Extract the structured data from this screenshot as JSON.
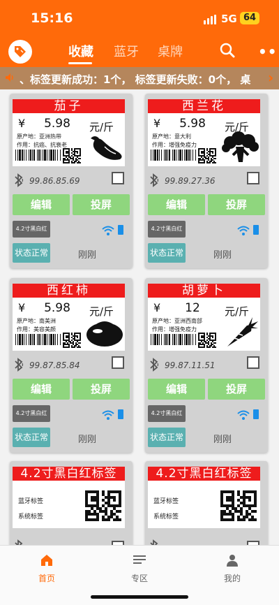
{
  "status_bar": {
    "time": "15:16",
    "network": "5G",
    "battery": "64"
  },
  "header": {
    "tabs": [
      {
        "label": "收藏"
      },
      {
        "label": "蓝牙"
      },
      {
        "label": "桌牌"
      }
    ],
    "logo_icon": "price-tag-icon",
    "search_icon": "search-icon",
    "more_label": "•••"
  },
  "marquee": {
    "text": "、标签更新成功：1个，  标签更新失败：0个，    桌",
    "arrow": "›"
  },
  "colors": {
    "brand": "#ff6a0a",
    "label_red": "#ee1c1c",
    "button_green": "#8fd67e",
    "status_teal": "#5ab0b0"
  },
  "cards": [
    {
      "name": "茄子",
      "currency": "¥",
      "price": "5.98",
      "unit": "元/斤",
      "origin": "原产地：亚洲热带",
      "effect": "作用：抗癌、抗衰老",
      "product_icon": "eggplant-icon",
      "mac": "99.86.85.69",
      "edit": "编辑",
      "project": "投屏",
      "size": "4.2寸黑白红",
      "status": "状态正常",
      "updated": "刚刚"
    },
    {
      "name": "西兰花",
      "currency": "¥",
      "price": "5.98",
      "unit": "元/斤",
      "origin": "原产地：意大利",
      "effect": "作用：增强免疫力",
      "product_icon": "broccoli-icon",
      "mac": "99.89.27.36",
      "edit": "编辑",
      "project": "投屏",
      "size": "4.2寸黑白红",
      "status": "状态正常",
      "updated": "刚刚"
    },
    {
      "name": "西红柿",
      "currency": "¥",
      "price": "5.98",
      "unit": "元/斤",
      "origin": "原产地：南美洲",
      "effect": "作用：美容美颜",
      "product_icon": "tomato-icon",
      "mac": "99.87.85.84",
      "edit": "编辑",
      "project": "投屏",
      "size": "4.2寸黑白红",
      "status": "状态正常",
      "updated": "刚刚"
    },
    {
      "name": "胡萝卜",
      "currency": "¥",
      "price": "12",
      "unit": "元/斤",
      "origin": "原产地：亚洲西南部",
      "effect": "作用：增强免疫力",
      "product_icon": "carrot-icon",
      "mac": "99.87.11.51",
      "edit": "编辑",
      "project": "投屏",
      "size": "4.2寸黑白红",
      "status": "状态正常",
      "updated": "刚刚"
    }
  ],
  "partial_cards": [
    {
      "title": "4.2寸黑白红标签",
      "line1": "蓝牙标签",
      "line2": "系统标签"
    },
    {
      "title": "4.2寸黑白红标签",
      "line1": "蓝牙标签",
      "line2": "系统标签"
    }
  ],
  "bottom_nav": [
    {
      "label": "首页",
      "icon": "home-icon"
    },
    {
      "label": "专区",
      "icon": "list-icon"
    },
    {
      "label": "我的",
      "icon": "person-icon"
    }
  ]
}
